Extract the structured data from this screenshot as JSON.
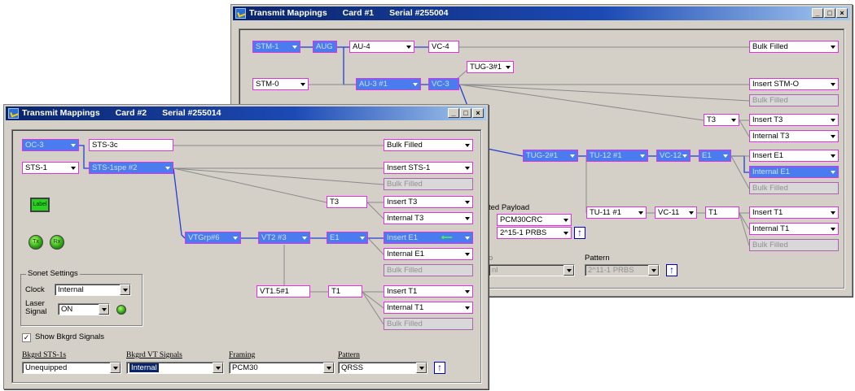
{
  "colors": {
    "title_start": "#0a246a",
    "title_end": "#a6caf0",
    "selected_box": "#4a7cf0",
    "border_magenta": "#e030e0",
    "line_blue": "#2040d0",
    "line_gray": "#808080"
  },
  "back_window": {
    "title": {
      "app": "Transmit Mappings",
      "card": "Card #1",
      "serial": "Serial #255004"
    },
    "controls": {
      "minimize": "_",
      "maximize": "□",
      "close": "×"
    },
    "nodes": {
      "stm1": "STM-1",
      "aug": "AUG",
      "au4": "AU-4",
      "vc4": "VC-4",
      "tug3": "TUG-3#1",
      "stm0": "STM-0",
      "au3": "AU-3 #1",
      "vc3": "VC-3",
      "tug2": "TUG-2#1",
      "tu12": "TU-12 #1",
      "vc12": "VC-12",
      "e1": "E1",
      "t3": "T3",
      "tu11": "TU-11 #1",
      "vc11": "VC-11",
      "t1": "T1"
    },
    "outputs": [
      "Bulk Filled",
      "Insert STM-O",
      "Bulk Filled",
      "Insert T3",
      "Internal T3",
      "Insert E1",
      "Internal E1",
      "Bulk Filled",
      "Insert T1",
      "Internal T1",
      "Bulk Filled"
    ],
    "payload": {
      "label": "ted Payload",
      "framing": "PCM30CRC",
      "pattern": "2^15-1 PRBS"
    },
    "pattern_row": {
      "label_left": "o",
      "label": "Pattern",
      "left_value": "nl",
      "value": "2^11-1 PRBS"
    }
  },
  "front_window": {
    "title": {
      "app": "Transmit Mappings",
      "card": "Card #2",
      "serial": "Serial #255014"
    },
    "controls": {
      "minimize": "_",
      "maximize": "□",
      "close": "×"
    },
    "nodes": {
      "oc3": "OC-3",
      "sts3c": "STS-3c",
      "sts1": "STS-1",
      "sts1spe": "STS-1spe #2",
      "vtgrp": "VTGrp#6",
      "vt2": "VT2 #3",
      "e1": "E1",
      "t3": "T3",
      "vt15": "VT1.5#1",
      "t1": "T1"
    },
    "outputs": [
      "Bulk Filled",
      "Insert STS-1",
      "Bulk Filled",
      "Insert T3",
      "Internal T3",
      "Insert E1",
      "Internal E1",
      "Bulk Filled",
      "Insert T1",
      "Internal T1",
      "Bulk Filled"
    ],
    "green_btn": "Label",
    "led_tx": "Tx",
    "led_rx": "Rx",
    "sonet": {
      "group": "Sonet Settings",
      "clock_label": "Clock",
      "clock_value": "Internal",
      "laser_label": "Laser Signal",
      "laser_value": "ON"
    },
    "show_bkgrd": {
      "label": "Show Bkgrd Signals",
      "checked": "✓"
    },
    "bottom": {
      "sts_label": "Bkgrd STS-1s",
      "sts_value": "Unequipped",
      "vt_label": "Bkgrd VT Signals",
      "vt_value": "Internal",
      "framing_label": "Framing",
      "framing_value": "PCM30",
      "pattern_label": "Pattern",
      "pattern_value": "QRSS"
    }
  }
}
